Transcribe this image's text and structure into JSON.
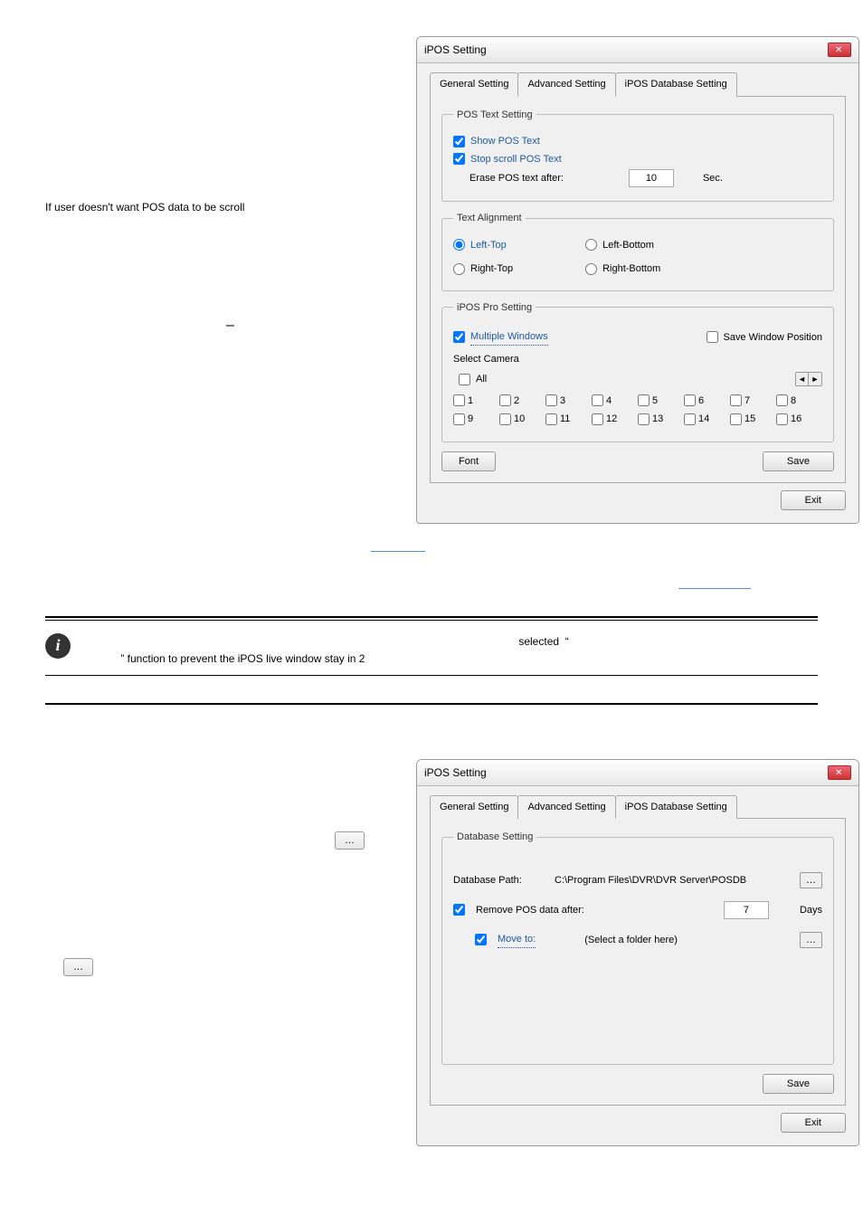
{
  "intro_text": "If user doesn't want POS data to be scroll",
  "dash": "–",
  "dialog1": {
    "title": "iPOS Setting",
    "tabs": {
      "general": "General Setting",
      "advanced": "Advanced Setting",
      "db": "iPOS Database Setting"
    },
    "pos_text_legend": "POS Text Setting",
    "show_pos_text": "Show POS Text",
    "stop_scroll": "Stop scroll POS Text",
    "erase_after_label": "Erase POS text after:",
    "erase_value": "10",
    "sec_label": "Sec.",
    "text_align_legend": "Text Alignment",
    "left_top": "Left-Top",
    "right_top": "Right-Top",
    "left_bottom": "Left-Bottom",
    "right_bottom": "Right-Bottom",
    "ipos_pro_legend": "iPOS Pro Setting",
    "multiple_windows": "Multiple Windows",
    "save_window_pos": "Save Window Position",
    "select_camera": "Select Camera",
    "all": "All",
    "prev": "◄",
    "next": "►",
    "cams": [
      "1",
      "2",
      "3",
      "4",
      "5",
      "6",
      "7",
      "8",
      "9",
      "10",
      "11",
      "12",
      "13",
      "14",
      "15",
      "16"
    ],
    "font_btn": "Font",
    "save_btn": "Save",
    "exit_btn": "Exit"
  },
  "info": {
    "selected": "selected",
    "quote_open": "“",
    "quote_close": "”",
    "func_text": " function to prevent the iPOS live window stay in 2"
  },
  "section2": {
    "list": {
      "browse_btn": "…",
      "browse_btn2": "…"
    }
  },
  "dialog2": {
    "title": "iPOS Setting",
    "tabs": {
      "general": "General Setting",
      "advanced": "Advanced Setting",
      "db": "iPOS Database Setting"
    },
    "db_legend": "Database Setting",
    "db_path_label": "Database Path:",
    "db_path_value": "C:\\Program Files\\DVR\\DVR Server\\POSDB",
    "remove_after": "Remove POS data after:",
    "remove_days": "7",
    "days_label": "Days",
    "move_to": "Move to:",
    "move_placeholder": "(Select a folder here)",
    "save_btn": "Save",
    "exit_btn": "Exit",
    "dots": "…"
  }
}
